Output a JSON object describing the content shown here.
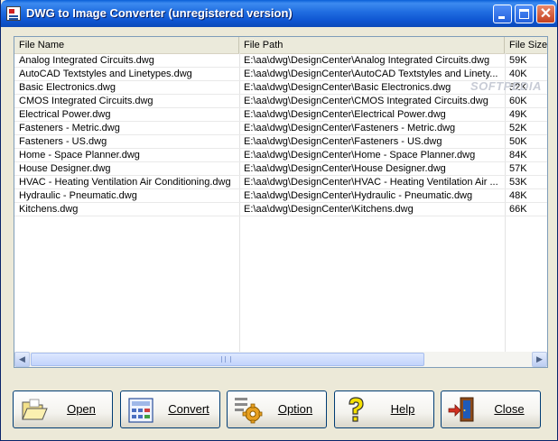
{
  "window": {
    "title": "DWG to Image Converter (unregistered version)",
    "controls": {
      "minimize_icon": "minimize-icon",
      "maximize_icon": "maximize-icon",
      "close_icon": "close-icon",
      "close_glyph": "✕"
    }
  },
  "list": {
    "columns": [
      "File Name",
      "File Path",
      "File Size"
    ],
    "rows": [
      {
        "name": "Analog Integrated Circuits.dwg",
        "path": "E:\\aa\\dwg\\DesignCenter\\Analog Integrated Circuits.dwg",
        "size": "59K"
      },
      {
        "name": "AutoCAD Textstyles and Linetypes.dwg",
        "path": "E:\\aa\\dwg\\DesignCenter\\AutoCAD Textstyles and Linety...",
        "size": "40K"
      },
      {
        "name": "Basic Electronics.dwg",
        "path": "E:\\aa\\dwg\\DesignCenter\\Basic Electronics.dwg",
        "size": "52K"
      },
      {
        "name": "CMOS Integrated Circuits.dwg",
        "path": "E:\\aa\\dwg\\DesignCenter\\CMOS Integrated Circuits.dwg",
        "size": "60K"
      },
      {
        "name": "Electrical Power.dwg",
        "path": "E:\\aa\\dwg\\DesignCenter\\Electrical Power.dwg",
        "size": "49K"
      },
      {
        "name": "Fasteners - Metric.dwg",
        "path": "E:\\aa\\dwg\\DesignCenter\\Fasteners - Metric.dwg",
        "size": "52K"
      },
      {
        "name": "Fasteners - US.dwg",
        "path": "E:\\aa\\dwg\\DesignCenter\\Fasteners - US.dwg",
        "size": "50K"
      },
      {
        "name": "Home - Space Planner.dwg",
        "path": "E:\\aa\\dwg\\DesignCenter\\Home - Space Planner.dwg",
        "size": "84K"
      },
      {
        "name": "House Designer.dwg",
        "path": "E:\\aa\\dwg\\DesignCenter\\House Designer.dwg",
        "size": "57K"
      },
      {
        "name": "HVAC - Heating Ventilation Air Conditioning.dwg",
        "path": "E:\\aa\\dwg\\DesignCenter\\HVAC - Heating Ventilation Air ...",
        "size": "53K"
      },
      {
        "name": "Hydraulic - Pneumatic.dwg",
        "path": "E:\\aa\\dwg\\DesignCenter\\Hydraulic - Pneumatic.dwg",
        "size": "48K"
      },
      {
        "name": "Kitchens.dwg",
        "path": "E:\\aa\\dwg\\DesignCenter\\Kitchens.dwg",
        "size": "66K"
      }
    ],
    "watermark": "SOFTPEDIA",
    "scrollbar": {
      "left_arrow": "◀",
      "right_arrow": "▶"
    }
  },
  "buttons": {
    "open": {
      "label": "Open",
      "icon": "folder-open-icon"
    },
    "convert": {
      "label": "Convert",
      "icon": "calculator-icon"
    },
    "option": {
      "label": "Option",
      "icon": "gear-icon"
    },
    "help": {
      "label": "Help",
      "icon": "question-mark-icon"
    },
    "close": {
      "label": "Close",
      "icon": "exit-door-icon"
    }
  },
  "colors": {
    "titlebar": "#0b56d8",
    "window_bg": "#ece9d8",
    "button_border": "#003c74",
    "list_border": "#7f9db9"
  }
}
